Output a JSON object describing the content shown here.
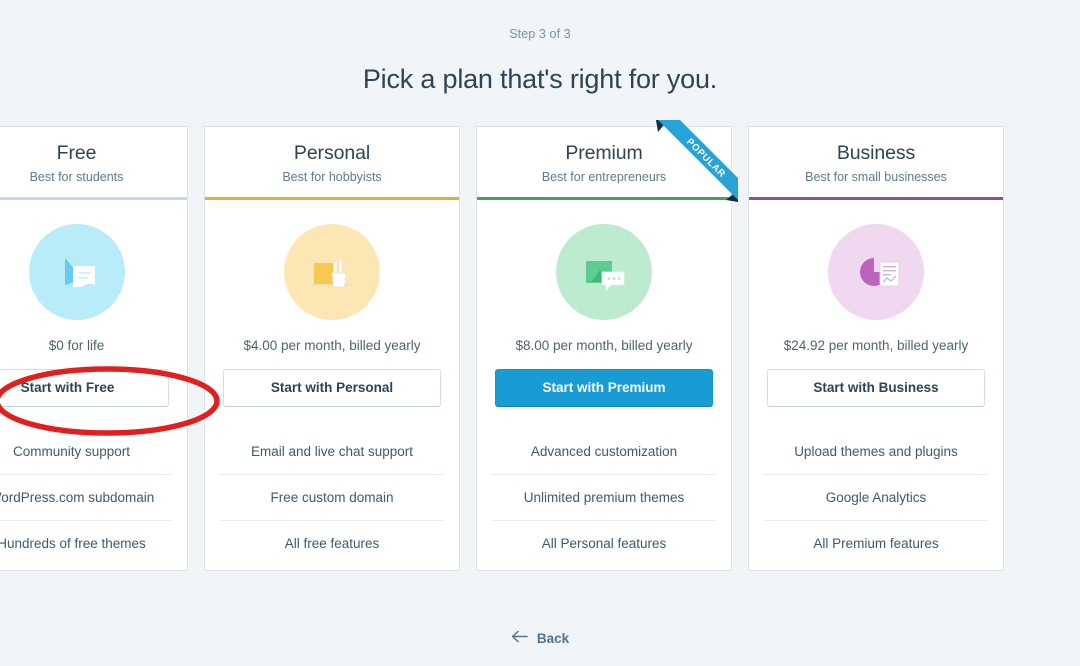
{
  "header": {
    "step_label": "Step 3 of 3",
    "title": "Pick a plan that's right for you."
  },
  "ribbon": {
    "label": "POPULAR",
    "color": "#27a3d8",
    "fold_color": "#0f2b43"
  },
  "background_color": "#f1f5f8",
  "plans": [
    {
      "name": "Free",
      "tagline": "Best for students",
      "accent_color": "#c8d7e1",
      "icon": "document-icon",
      "icon_circle_color": "#b9ecf9",
      "icon_primary_color": "#68c8ef",
      "price": "$0 for life",
      "cta_label": "Start with Free",
      "cta_style": "outline",
      "features": [
        "Community support",
        "WordPress.com subdomain",
        "Hundreds of free themes"
      ]
    },
    {
      "name": "Personal",
      "tagline": "Best for hobbyists",
      "accent_color": "#e9a93b",
      "icon": "pencil-cup-icon",
      "icon_circle_color": "#fbe6b4",
      "icon_primary_color": "#f4ca52",
      "price": "$4.00 per month, billed yearly",
      "cta_label": "Start with Personal",
      "cta_style": "outline",
      "features": [
        "Email and live chat support",
        "Free custom domain",
        "All free features"
      ]
    },
    {
      "name": "Premium",
      "tagline": "Best for entrepreneurs",
      "accent_color": "#3ea75a",
      "icon": "chat-bubble-icon",
      "icon_circle_color": "#bdebcf",
      "icon_primary_color": "#5ecb93",
      "price": "$8.00 per month, billed yearly",
      "cta_label": "Start with Premium",
      "cta_style": "primary",
      "badge": "POPULAR",
      "features": [
        "Advanced customization",
        "Unlimited premium themes",
        "All Personal features"
      ]
    },
    {
      "name": "Business",
      "tagline": "Best for small businesses",
      "accent_color": "#8a4f9e",
      "icon": "pie-chart-report-icon",
      "icon_circle_color": "#f0d9f0",
      "icon_primary_color": "#bb64bd",
      "price": "$24.92 per month, billed yearly",
      "cta_label": "Start with Business",
      "cta_style": "outline",
      "features": [
        "Upload themes and plugins",
        "Google Analytics",
        "All Premium features"
      ]
    }
  ],
  "footer": {
    "back_label": "Back"
  },
  "annotation": {
    "shape": "ellipse",
    "color": "#e01f1f",
    "targets": "Start with Free"
  }
}
